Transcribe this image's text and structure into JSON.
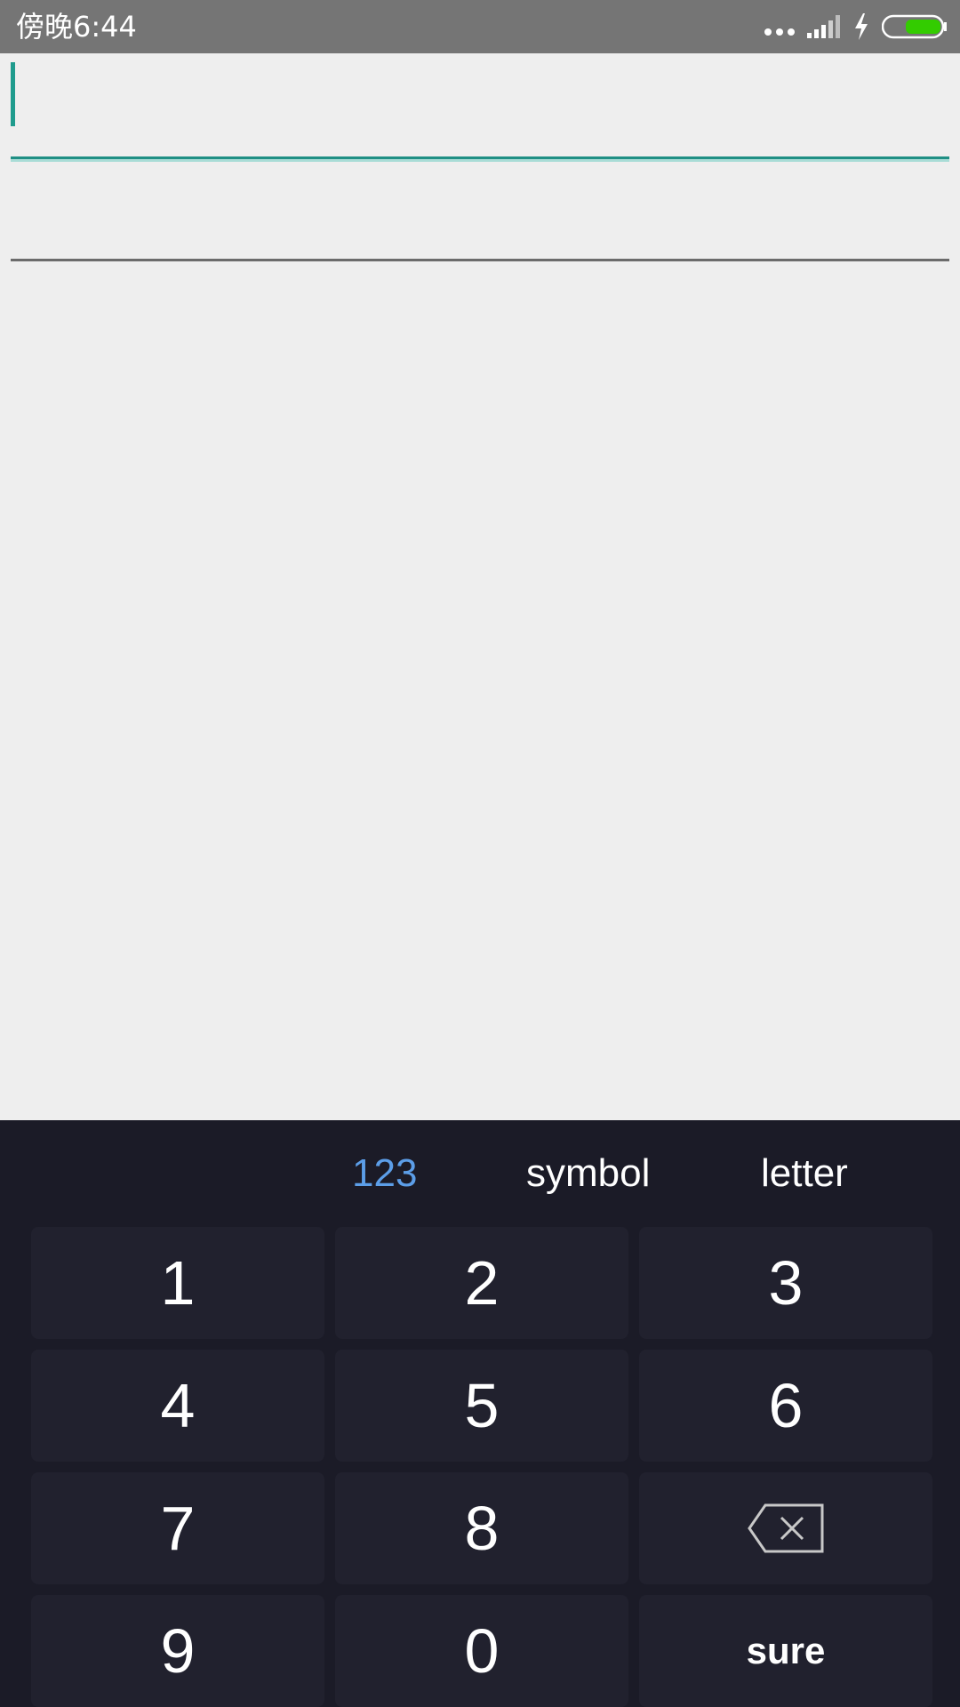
{
  "status_bar": {
    "time": "傍晚6:44",
    "icons": [
      "more-dots-icon",
      "signal-icon",
      "charging-icon",
      "battery-icon"
    ],
    "battery_color": "#33cc00"
  },
  "form": {
    "field1_value": "",
    "field2_value": "",
    "accent_color": "#1f9b8d"
  },
  "keyboard": {
    "tabs": [
      {
        "label": "123",
        "active": true
      },
      {
        "label": "symbol",
        "active": false
      },
      {
        "label": "letter",
        "active": false
      }
    ],
    "keys": [
      "1",
      "2",
      "3",
      "4",
      "5",
      "6",
      "7",
      "8",
      "backspace",
      "9",
      "0",
      "sure"
    ],
    "active_color": "#5c9ee8",
    "background_color": "#1b1b27"
  }
}
